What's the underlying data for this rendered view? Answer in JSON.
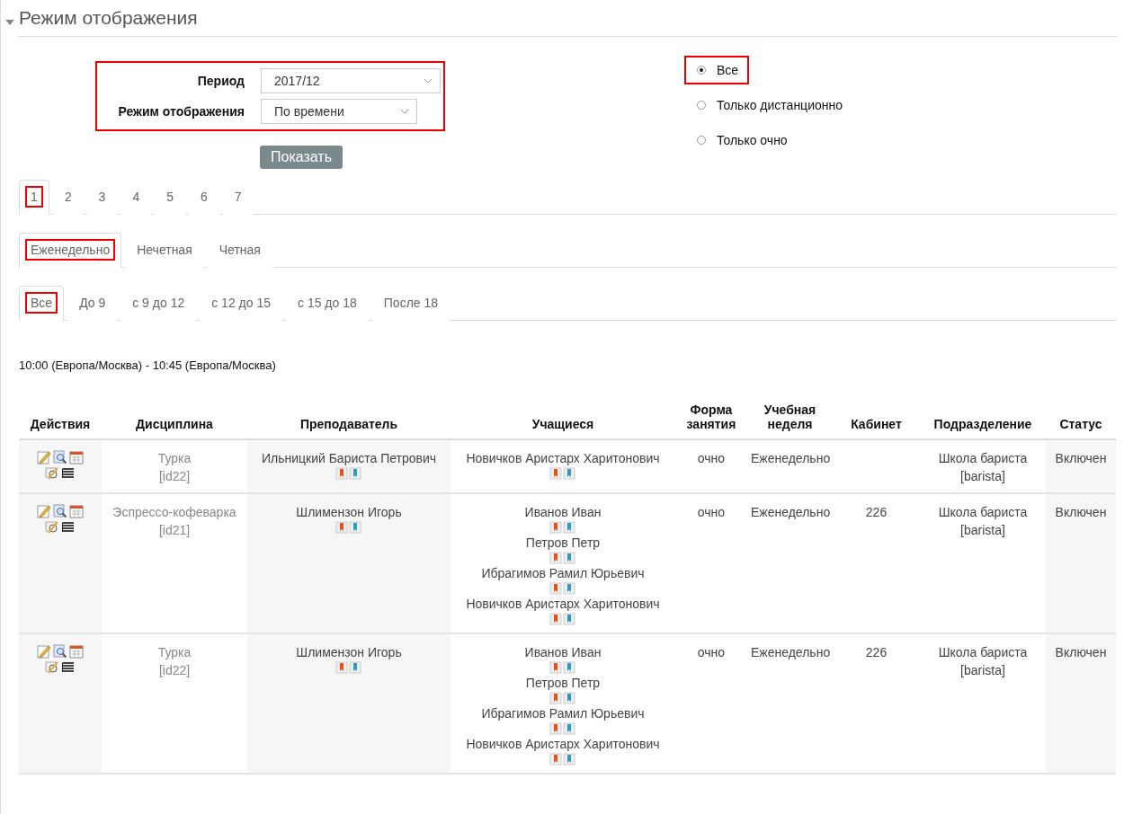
{
  "section": {
    "title": "Режим отображения",
    "expanded": true
  },
  "filters": [
    {
      "label": "Период",
      "value": "2017/12"
    },
    {
      "label": "Режим отображения",
      "value": "По времени"
    }
  ],
  "show_button": "Показать",
  "attendance": [
    {
      "label": "Все",
      "selected": true
    },
    {
      "label": "Только дистанционно",
      "selected": false
    },
    {
      "label": "Только очно",
      "selected": false
    }
  ],
  "page_tabs": [
    {
      "label": "1",
      "selected": true
    },
    {
      "label": "2",
      "selected": false
    },
    {
      "label": "3",
      "selected": false
    },
    {
      "label": "4",
      "selected": false
    },
    {
      "label": "5",
      "selected": false
    },
    {
      "label": "6",
      "selected": false
    },
    {
      "label": "7",
      "selected": false
    }
  ],
  "week_tabs": [
    {
      "label": "Еженедельно",
      "selected": true
    },
    {
      "label": "Нечетная",
      "selected": false
    },
    {
      "label": "Четная",
      "selected": false
    }
  ],
  "time_tabs": [
    {
      "label": "Все",
      "selected": true
    },
    {
      "label": "До 9",
      "selected": false
    },
    {
      "label": "с 9 до 12",
      "selected": false
    },
    {
      "label": "с 12 до 15",
      "selected": false
    },
    {
      "label": "с 15 до 18",
      "selected": false
    },
    {
      "label": "После 18",
      "selected": false
    }
  ],
  "time_range": "10:00 (Европа/Москва) - 10:45 (Европа/Москва)",
  "table": {
    "columns": [
      "Действия",
      "Дисциплина",
      "Преподаватель",
      "Учащиеся",
      "Форма занятия",
      "Учебная неделя",
      "Кабинет",
      "Подразделение",
      "Статус"
    ],
    "rows": [
      {
        "discipline": "Турка",
        "discipline_id": "[id22]",
        "teacher": "Ильницкий Бариста Петрович",
        "students": [
          "Новичков Аристарх Харитонович"
        ],
        "form": "очно",
        "week": "Еженедельно",
        "department": "Школа бариста",
        "department_code": "[barista]",
        "status": "Включен"
      },
      {
        "discipline": "Эспрессо-кофеварка",
        "discipline_id": "[id21]",
        "teacher": "Шлимензон Игорь",
        "students": [
          "Иванов Иван",
          "Петров Петр",
          "Ибрагимов Рамил Юрьевич",
          "Новичков Аристарх Харитонович"
        ],
        "form": "очно",
        "week": "Еженедельно",
        "room": "226",
        "department": "Школа бариста",
        "department_code": "[barista]",
        "status": "Включен"
      },
      {
        "discipline": "Турка",
        "discipline_id": "[id22]",
        "teacher": "Шлимензон Игорь",
        "students": [
          "Иванов Иван",
          "Петров Петр",
          "Ибрагимов Рамил Юрьевич",
          "Новичков Аристарх Харитонович"
        ],
        "form": "очно",
        "week": "Еженедельно",
        "room": "226",
        "department": "Школа бариста",
        "department_code": "[barista]",
        "status": "Включен"
      }
    ]
  }
}
